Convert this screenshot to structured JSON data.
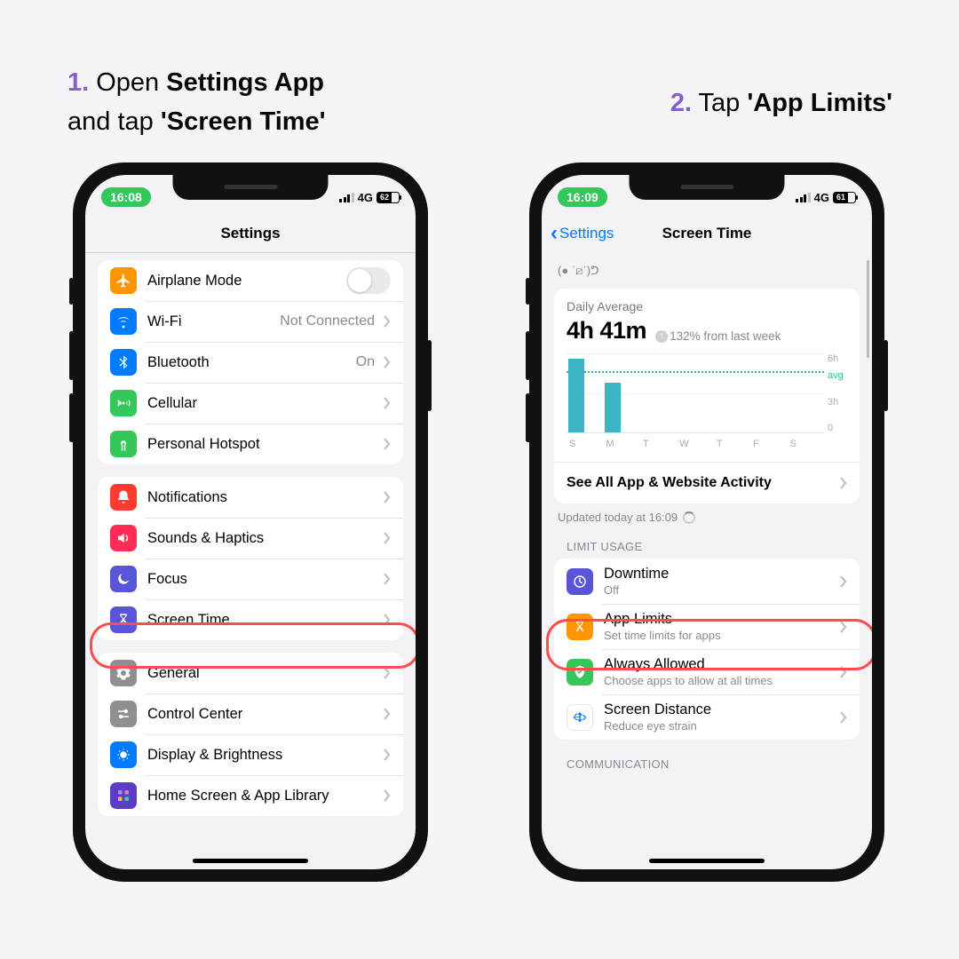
{
  "captions": {
    "step1_num": "1.",
    "step1_a": " Open ",
    "step1_b": "Settings App",
    "step1_c": " and tap ",
    "step1_d": "'Screen Time'",
    "step2_num": "2.",
    "step2_a": " Tap ",
    "step2_b": "'App Limits'"
  },
  "phone1": {
    "time": "16:08",
    "network": "4G",
    "battery": "62",
    "title": "Settings",
    "group1": [
      {
        "icon": "airplane",
        "color": "#ff9500",
        "label": "Airplane Mode",
        "toggle": true
      },
      {
        "icon": "wifi",
        "color": "#007aff",
        "label": "Wi-Fi",
        "value": "Not Connected",
        "chevron": true
      },
      {
        "icon": "bluetooth",
        "color": "#007aff",
        "label": "Bluetooth",
        "value": "On",
        "chevron": true
      },
      {
        "icon": "cellular",
        "color": "#34c759",
        "label": "Cellular",
        "chevron": true
      },
      {
        "icon": "hotspot",
        "color": "#34c759",
        "label": "Personal Hotspot",
        "chevron": true
      }
    ],
    "group2": [
      {
        "icon": "bell",
        "color": "#ff3b30",
        "label": "Notifications",
        "chevron": true
      },
      {
        "icon": "speaker",
        "color": "#ff2d55",
        "label": "Sounds & Haptics",
        "chevron": true
      },
      {
        "icon": "moon",
        "color": "#5856d6",
        "label": "Focus",
        "chevron": true
      },
      {
        "icon": "hourglass",
        "color": "#5856d6",
        "label": "Screen Time",
        "chevron": true
      }
    ],
    "group3": [
      {
        "icon": "gear",
        "color": "#8e8e93",
        "label": "General",
        "chevron": true
      },
      {
        "icon": "switches",
        "color": "#8e8e93",
        "label": "Control Center",
        "chevron": true
      },
      {
        "icon": "brightness",
        "color": "#007aff",
        "label": "Display & Brightness",
        "chevron": true
      },
      {
        "icon": "grid",
        "color": "#5b3cc4",
        "label": "Home Screen & App Library",
        "chevron": true
      }
    ]
  },
  "phone2": {
    "time": "16:09",
    "network": "4G",
    "battery": "61",
    "back": "Settings",
    "title": "Screen Time",
    "device_label": "(● ˈ⧄ˈ)ᕤ",
    "card": {
      "title": "Daily Average",
      "value": "4h 41m",
      "change": "132% from last week",
      "see_all": "See All App & Website Activity"
    },
    "updated": "Updated today at 16:09",
    "limit_header": "LIMIT USAGE",
    "limits": [
      {
        "icon": "downtime",
        "color": "#5856d6",
        "label": "Downtime",
        "desc": "Off"
      },
      {
        "icon": "hourglass",
        "color": "#ff9500",
        "label": "App Limits",
        "desc": "Set time limits for apps"
      },
      {
        "icon": "shield",
        "color": "#34c759",
        "label": "Always Allowed",
        "desc": "Choose apps to allow at all times"
      },
      {
        "icon": "distance",
        "color": "#ffffff",
        "fg": "#007aff",
        "label": "Screen Distance",
        "desc": "Reduce eye strain"
      }
    ],
    "comm_header": "COMMUNICATION"
  },
  "chart_data": {
    "type": "bar",
    "categories": [
      "S",
      "M",
      "T",
      "W",
      "T",
      "F",
      "S"
    ],
    "values": [
      5.6,
      3.8,
      0,
      0,
      0,
      0,
      0
    ],
    "ylabel_ticks": [
      "6h",
      "avg",
      "3h",
      "0"
    ],
    "ylim": [
      0,
      6
    ],
    "avg_y": 4.7,
    "title": "Daily Average"
  }
}
